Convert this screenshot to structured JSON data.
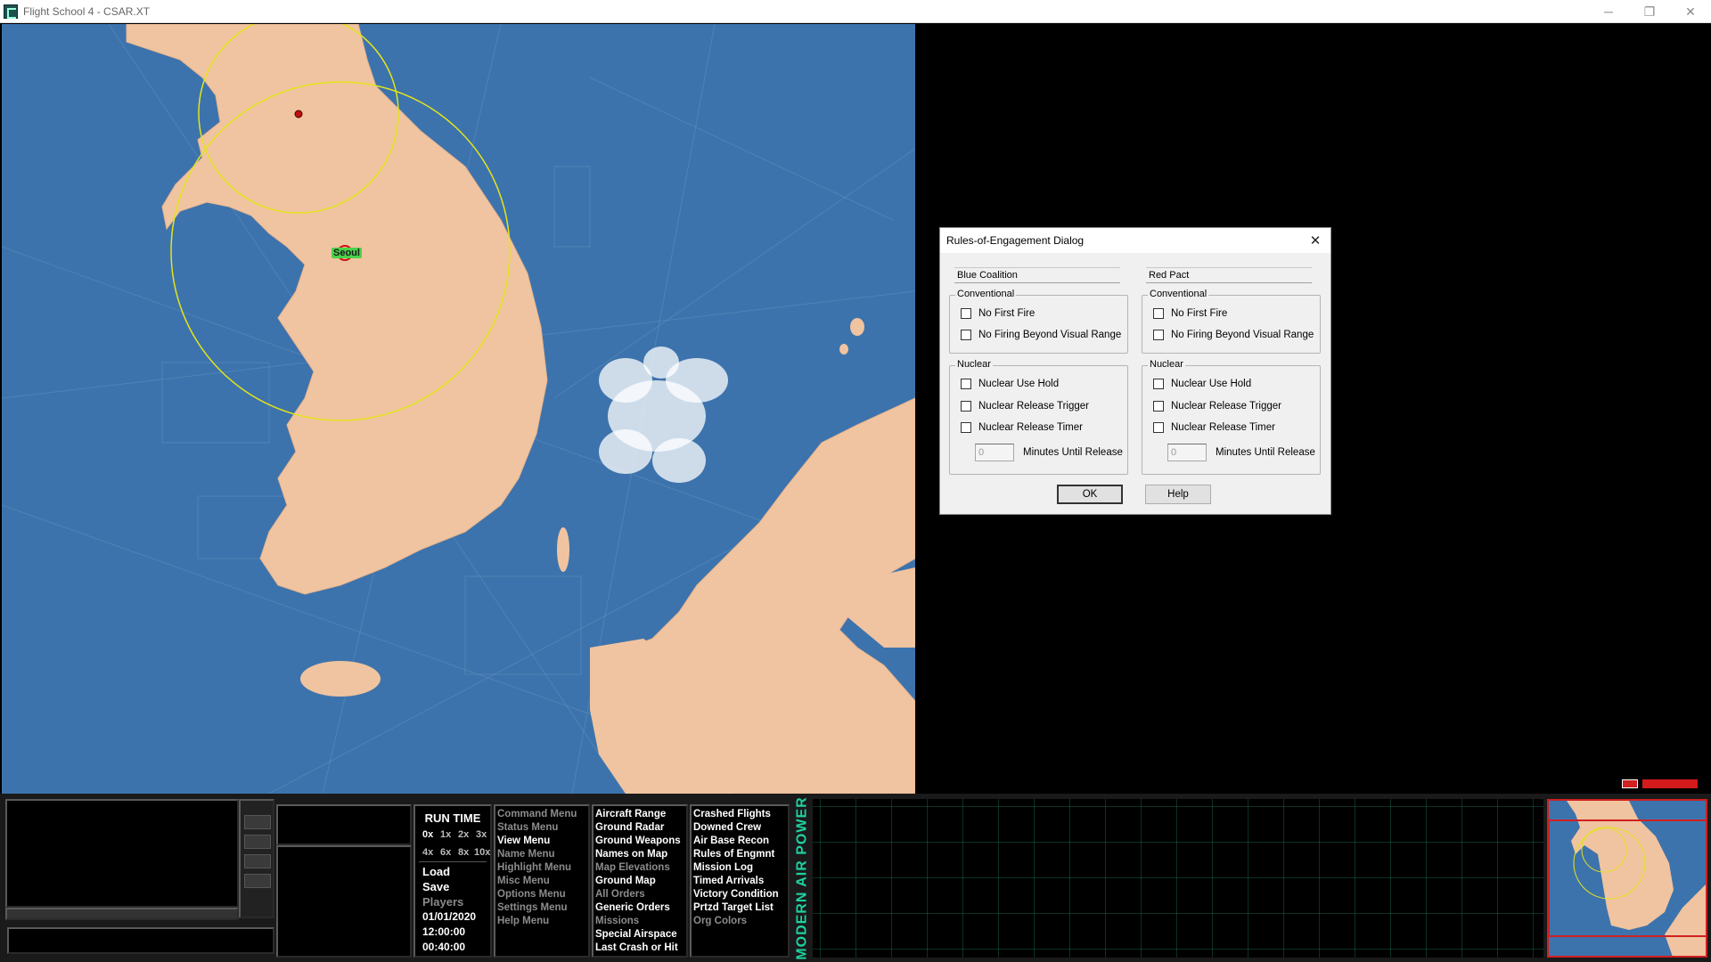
{
  "window": {
    "title": "Flight School 4 - CSAR.XT",
    "controls": {
      "minimize": "─",
      "restore": "❐",
      "close": "✕"
    }
  },
  "map": {
    "city_label": "Seoul",
    "colors": {
      "sea": "#3d73ac",
      "land": "#f0c4a0",
      "range_ring": "#e4e41a"
    }
  },
  "dialog": {
    "title": "Rules-of-Engagement Dialog",
    "sides": [
      {
        "name": "Blue Coalition",
        "conventional_label": "Conventional",
        "conventional": [
          "No First Fire",
          "No Firing Beyond Visual Range"
        ],
        "nuclear_label": "Nuclear",
        "nuclear": [
          "Nuclear Use Hold",
          "Nuclear Release Trigger",
          "Nuclear Release Timer"
        ],
        "timer_value": "0",
        "timer_label": "Minutes Until Release"
      },
      {
        "name": "Red Pact",
        "conventional_label": "Conventional",
        "conventional": [
          "No First Fire",
          "No Firing Beyond Visual Range"
        ],
        "nuclear_label": "Nuclear",
        "nuclear": [
          "Nuclear Use Hold",
          "Nuclear Release Trigger",
          "Nuclear Release Timer"
        ],
        "timer_value": "0",
        "timer_label": "Minutes Until Release"
      }
    ],
    "ok_label": "OK",
    "help_label": "Help"
  },
  "runtime": {
    "title": "RUN TIME",
    "speeds_row1": [
      "0x",
      "1x",
      "2x",
      "3x"
    ],
    "speeds_row2": [
      "4x",
      "6x",
      "8x",
      "10x"
    ],
    "active_speed": "0x",
    "load": "Load",
    "save": "Save",
    "players": "Players",
    "date": "01/01/2020",
    "time": "12:00:00",
    "elapsed": "00:40:00"
  },
  "menus": {
    "col1": [
      {
        "label": "Command Menu",
        "bright": false
      },
      {
        "label": "Status Menu",
        "bright": false
      },
      {
        "label": "View Menu",
        "bright": true
      },
      {
        "label": "Name Menu",
        "bright": false
      },
      {
        "label": "Highlight Menu",
        "bright": false
      },
      {
        "label": "Misc Menu",
        "bright": false
      },
      {
        "label": "Options Menu",
        "bright": false
      },
      {
        "label": "Settings Menu",
        "bright": false
      },
      {
        "label": "Help Menu",
        "bright": false
      }
    ],
    "col2": [
      {
        "label": "Aircraft Range",
        "bright": true
      },
      {
        "label": "Ground Radar",
        "bright": true
      },
      {
        "label": "Ground Weapons",
        "bright": true
      },
      {
        "label": "Names on Map",
        "bright": true
      },
      {
        "label": "Map Elevations",
        "bright": false
      },
      {
        "label": "Ground Map",
        "bright": true
      },
      {
        "label": "All Orders",
        "bright": false
      },
      {
        "label": "Generic Orders",
        "bright": true
      },
      {
        "label": "Missions",
        "bright": false
      },
      {
        "label": "Special Airspace",
        "bright": true
      },
      {
        "label": "Last Crash or Hit",
        "bright": true
      }
    ],
    "col3": [
      {
        "label": "Crashed Flights",
        "bright": true
      },
      {
        "label": "Downed Crew",
        "bright": true
      },
      {
        "label": "Air Base Recon",
        "bright": true
      },
      {
        "label": "Rules of Engmnt",
        "bright": true
      },
      {
        "label": "Mission Log",
        "bright": true
      },
      {
        "label": "Timed Arrivals",
        "bright": true
      },
      {
        "label": "Victory Condition",
        "bright": true
      },
      {
        "label": "Prtzd Target List",
        "bright": true
      },
      {
        "label": "Org Colors",
        "bright": false
      }
    ]
  },
  "logo": "MODERN AIR POWER"
}
